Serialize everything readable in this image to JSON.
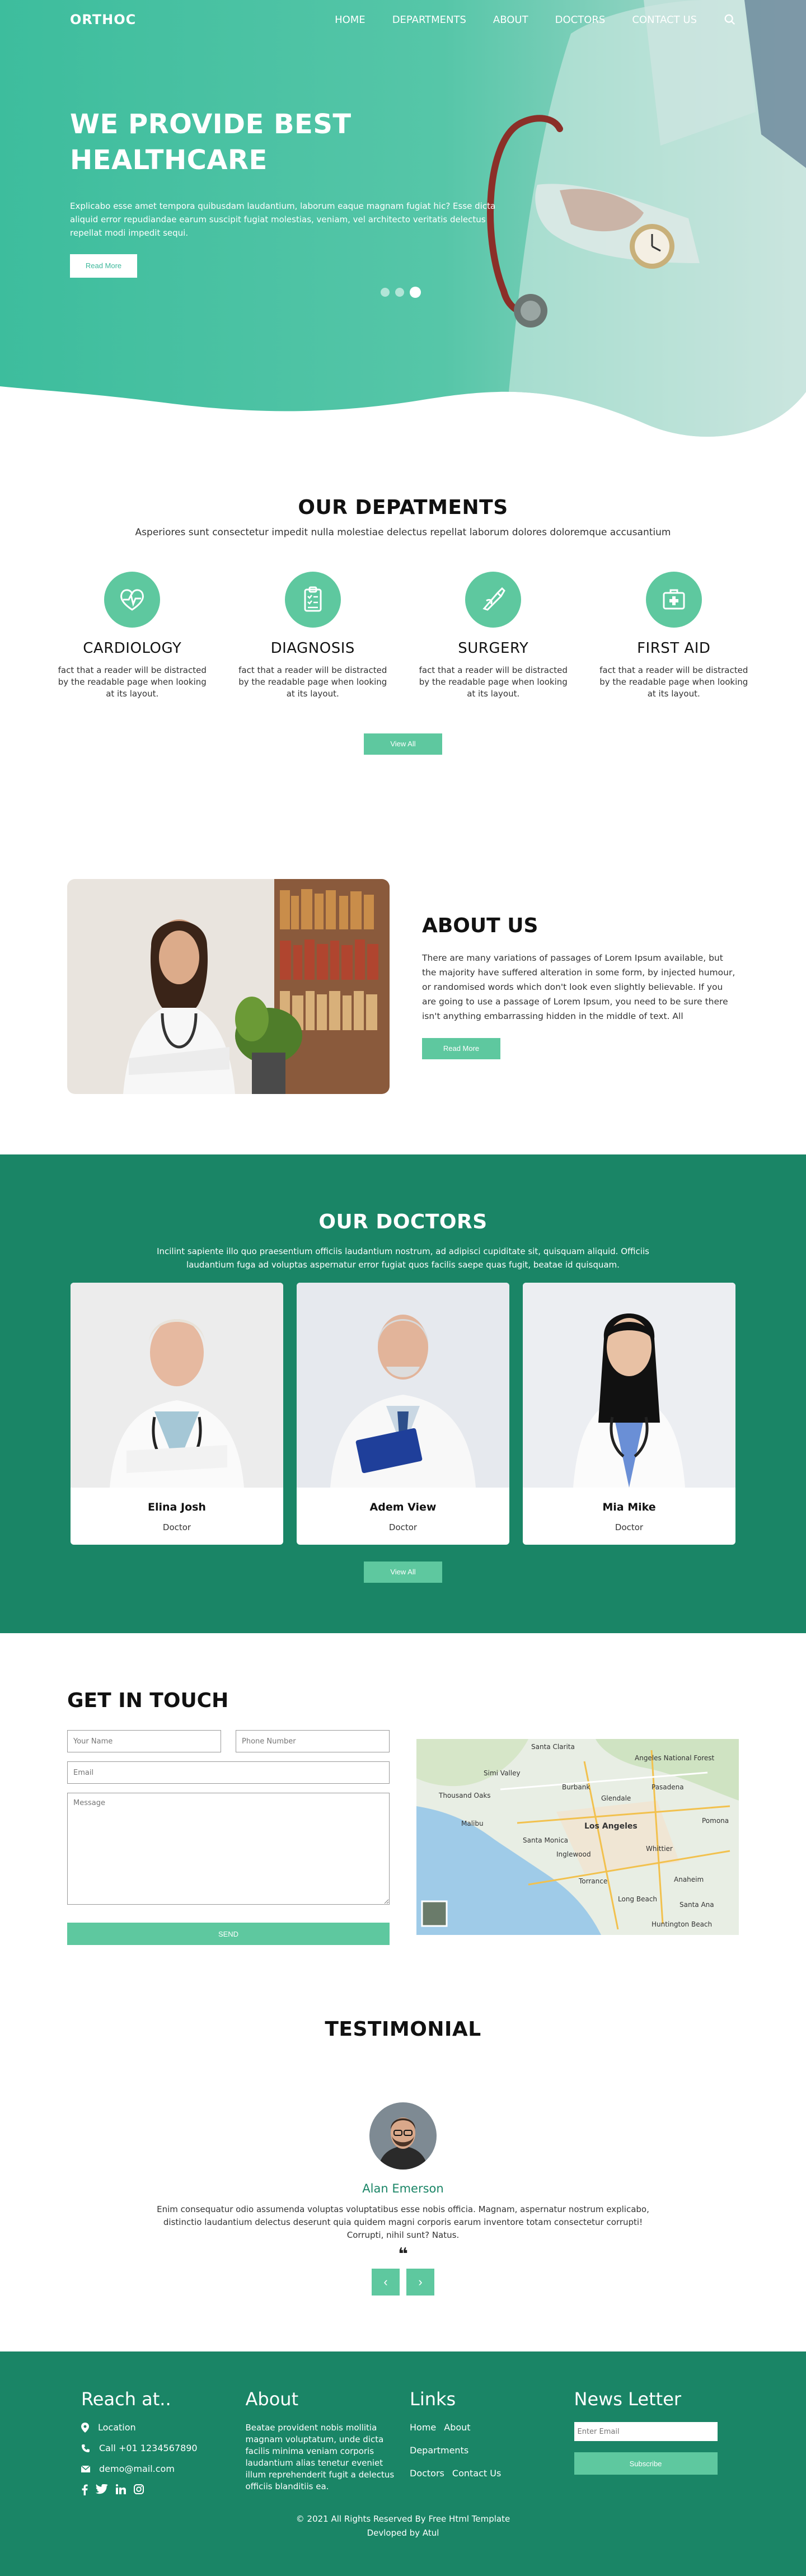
{
  "nav": {
    "logo": "ORTHOC",
    "items": [
      "HOME",
      "DEPARTMENTS",
      "ABOUT",
      "DOCTORS",
      "CONTACT US"
    ]
  },
  "hero": {
    "title": "WE PROVIDE BEST HEALTHCARE",
    "text": "Explicabo esse amet tempora quibusdam laudantium, laborum eaque magnam fugiat hic? Esse dicta aliquid error repudiandae earum suscipit fugiat molestias, veniam, vel architecto veritatis delectus repellat modi impedit sequi.",
    "button": "Read More",
    "slides": 3,
    "active_slide": 3
  },
  "departments": {
    "title": "OUR DEPATMENTS",
    "subtitle": "Asperiores sunt consectetur impedit nulla molestiae delectus repellat laborum dolores doloremque accusantium",
    "items": [
      {
        "name": "CARDIOLOGY",
        "desc": "fact that a reader will be distracted by the readable page when looking at its layout.",
        "icon": "heart-pulse-icon"
      },
      {
        "name": "DIAGNOSIS",
        "desc": "fact that a reader will be distracted by the readable page when looking at its layout.",
        "icon": "clipboard-icon"
      },
      {
        "name": "SURGERY",
        "desc": "fact that a reader will be distracted by the readable page when looking at its layout.",
        "icon": "scalpel-icon"
      },
      {
        "name": "FIRST AID",
        "desc": "fact that a reader will be distracted by the readable page when looking at its layout.",
        "icon": "first-aid-kit-icon"
      }
    ],
    "button": "View All"
  },
  "about": {
    "title": "ABOUT US",
    "text": "There are many variations of passages of Lorem Ipsum available, but the majority have suffered alteration in some form, by injected humour, or randomised words which don't look even slightly believable. If you are going to use a passage of Lorem Ipsum, you need to be sure there isn't anything embarrassing hidden in the middle of text. All",
    "button": "Read More"
  },
  "doctors": {
    "title": "OUR DOCTORS",
    "subtitle": "Incilint sapiente illo quo praesentium officiis laudantium nostrum, ad adipisci cupiditate sit, quisquam aliquid. Officiis laudantium fuga ad voluptas aspernatur error fugiat quos facilis saepe quas fugit, beatae id quisquam.",
    "items": [
      {
        "name": "Elina Josh",
        "role": "Doctor"
      },
      {
        "name": "Adem View",
        "role": "Doctor"
      },
      {
        "name": "Mia Mike",
        "role": "Doctor"
      }
    ],
    "button": "View All"
  },
  "contact": {
    "title": "GET IN TOUCH",
    "name_placeholder": "Your Name",
    "phone_placeholder": "Phone Number",
    "email_placeholder": "Email",
    "message_placeholder": "Message",
    "button": "SEND",
    "map_labels": [
      "Santa Clarita",
      "Simi Valley",
      "Thousand Oaks",
      "Los Angeles",
      "Angeles National Forest",
      "Long Beach",
      "Torrance",
      "Anaheim",
      "Santa Ana",
      "Huntington Beach",
      "Glendale",
      "Burbank",
      "Pasadena",
      "Malibu",
      "Santa Monica",
      "Inglewood",
      "Whittier",
      "Pomona"
    ]
  },
  "testimonial": {
    "title": "TESTIMONIAL",
    "name": "Alan Emerson",
    "text": "Enim consequatur odio assumenda voluptas voluptatibus esse nobis officia. Magnam, aspernatur nostrum explicabo, distinctio laudantium delectus deserunt quia quidem magni corporis earum inventore totam consectetur corrupti! Corrupti, nihil sunt? Natus.",
    "quote": "❝",
    "prev": "‹",
    "next": "›"
  },
  "footer": {
    "reach_title": "Reach at..",
    "location": "Location",
    "phone": "Call +01 1234567890",
    "email": "demo@mail.com",
    "about_title": "About",
    "about_text": "Beatae provident nobis mollitia magnam voluptatum, unde dicta facilis minima veniam corporis laudantium alias tenetur eveniet illum reprehenderit fugit a delectus officiis blanditiis ea.",
    "links_title": "Links",
    "links": [
      "Home",
      "About",
      "Departments",
      "Doctors",
      "Contact Us"
    ],
    "news_title": "News Letter",
    "news_placeholder": "Enter Email",
    "subscribe": "Subscribe",
    "copyright": "© 2021 All Rights Reserved By Free Html Template",
    "developer": "Devloped by Atul"
  },
  "colors": {
    "primary": "#5ec89f",
    "dark": "#1a8566",
    "hero": "#2fb597"
  }
}
